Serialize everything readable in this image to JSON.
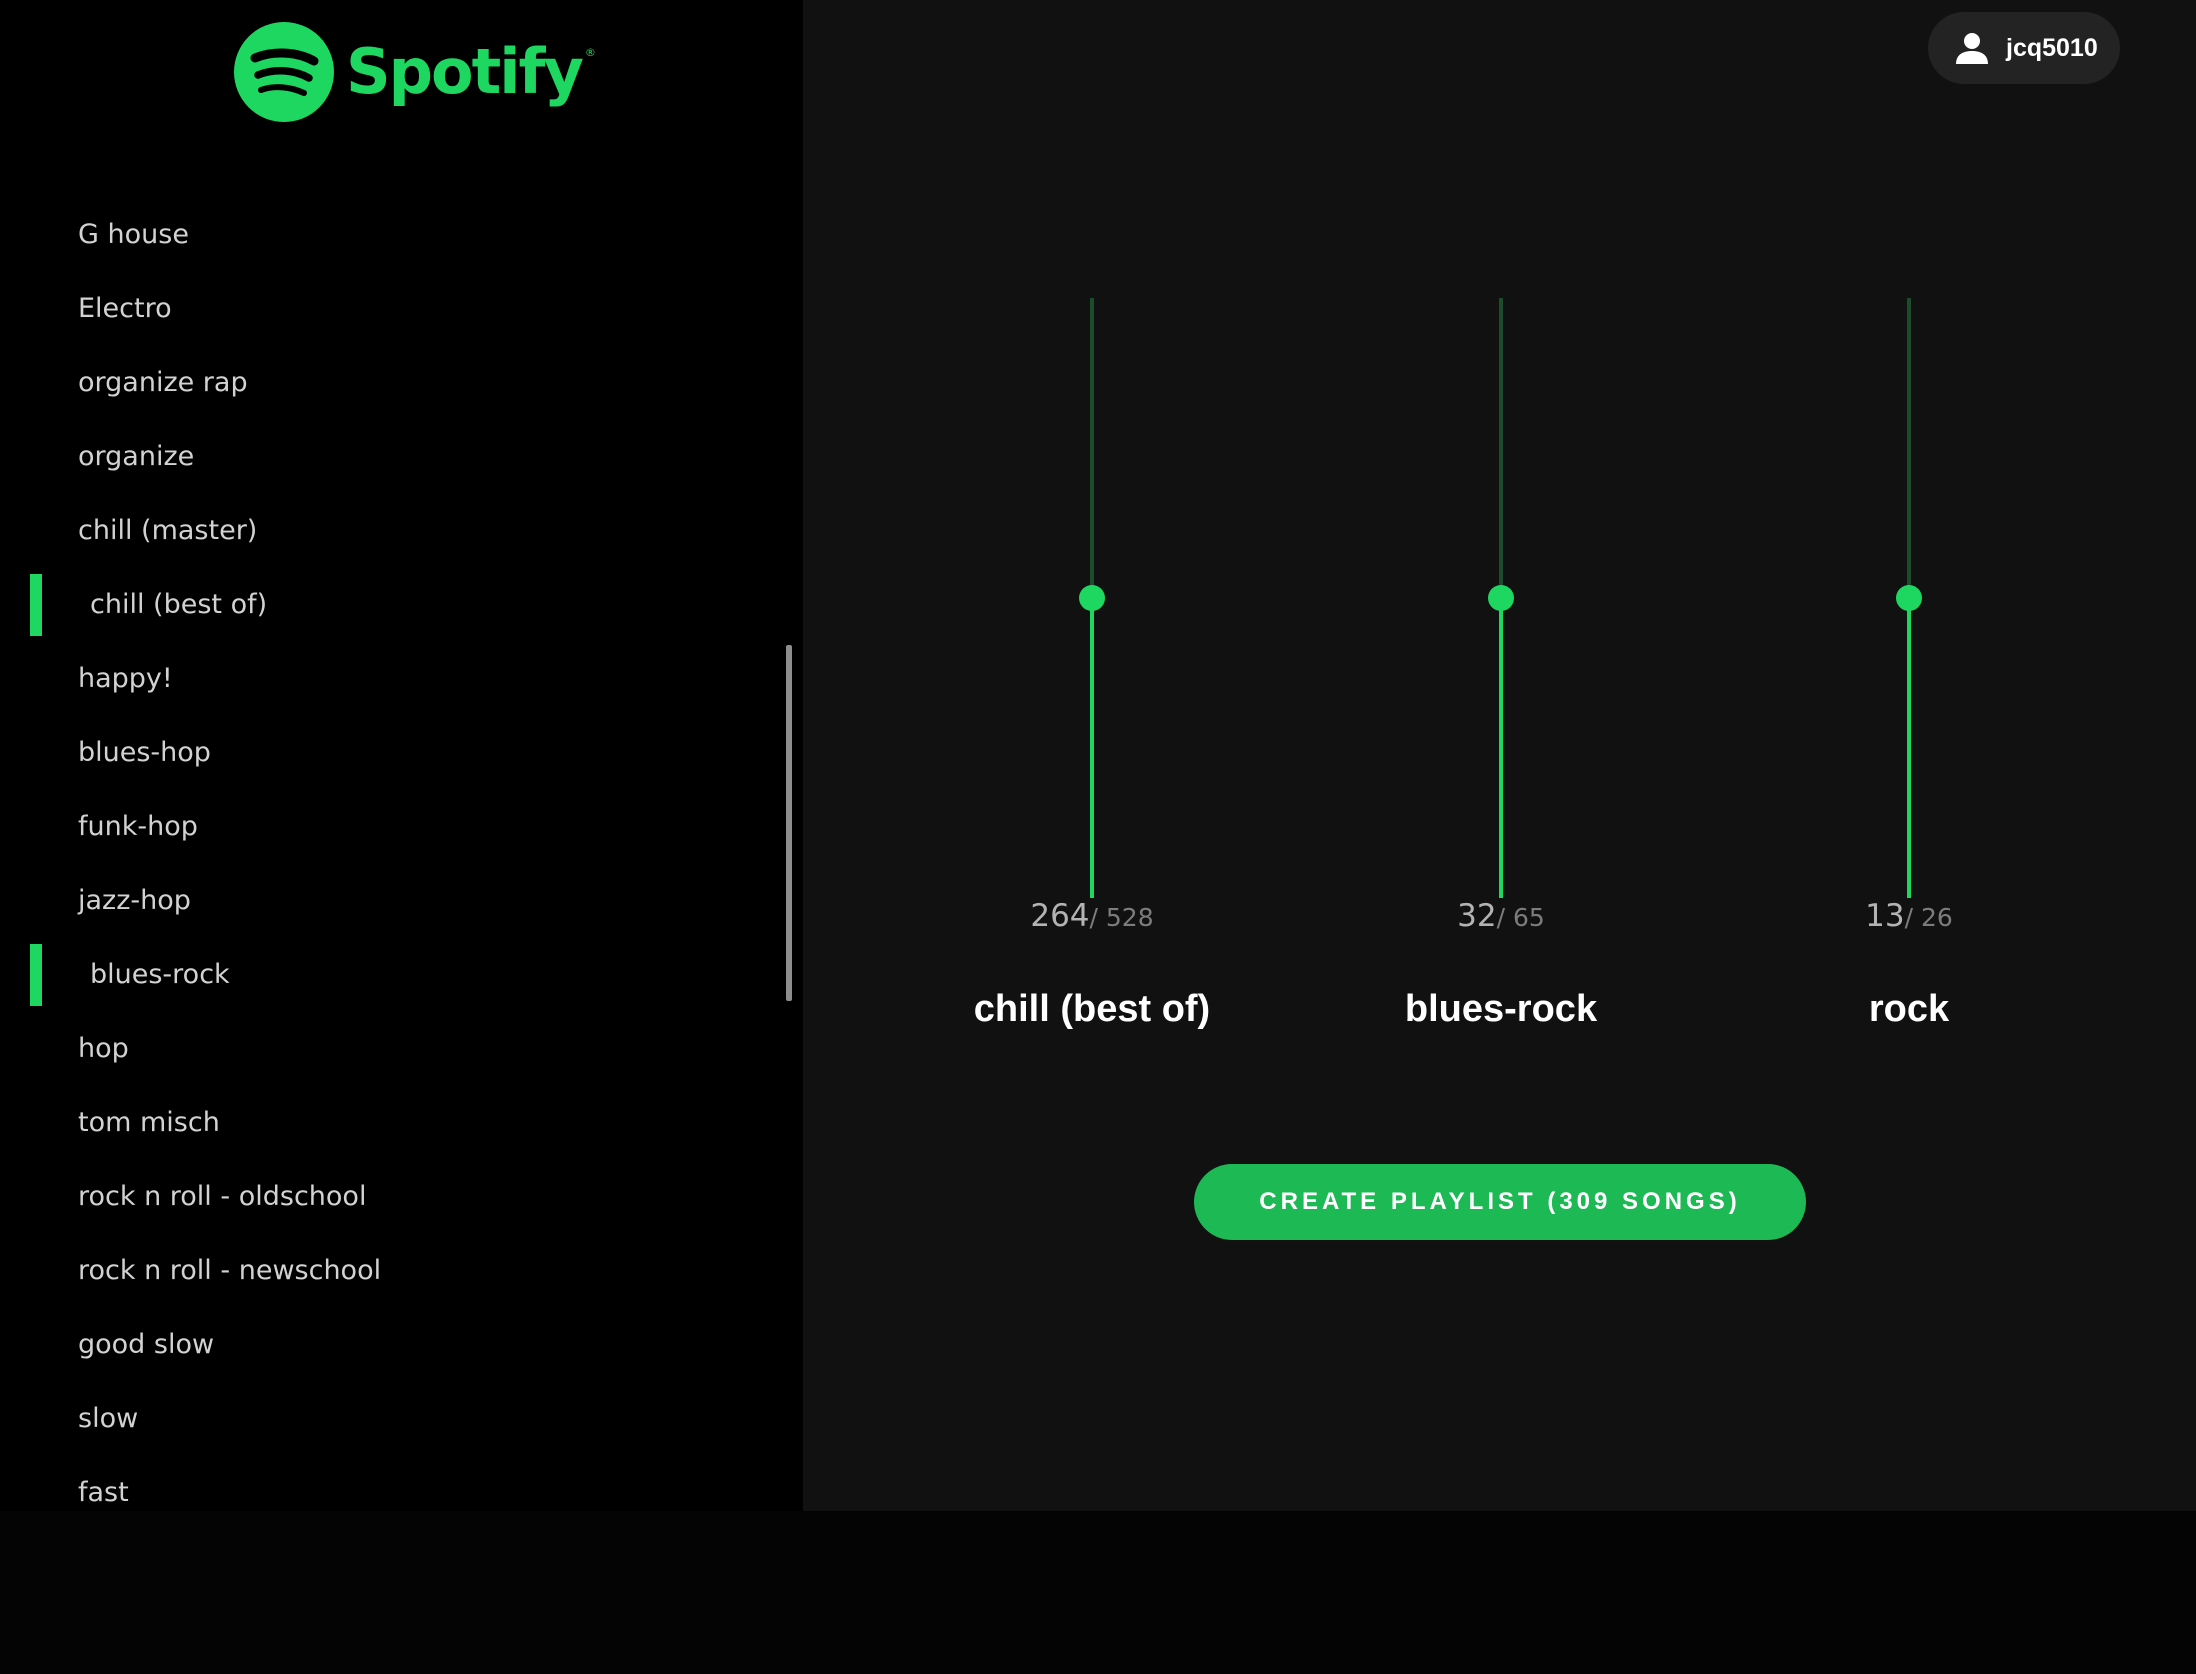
{
  "brand": {
    "name": "Spotify",
    "registered_mark": "®",
    "color": "#1ed760"
  },
  "user": {
    "icon": "user-icon",
    "username": "jcq5010"
  },
  "sidebar": {
    "items": [
      {
        "label": "G house",
        "selected": false
      },
      {
        "label": "Electro",
        "selected": false
      },
      {
        "label": "organize rap",
        "selected": false
      },
      {
        "label": "organize",
        "selected": false
      },
      {
        "label": "chill (master)",
        "selected": false
      },
      {
        "label": "chill (best of)",
        "selected": true
      },
      {
        "label": "happy!",
        "selected": false
      },
      {
        "label": "blues-hop",
        "selected": false
      },
      {
        "label": "funk-hop",
        "selected": false
      },
      {
        "label": "jazz-hop",
        "selected": false
      },
      {
        "label": "blues-rock",
        "selected": true
      },
      {
        "label": "hop",
        "selected": false
      },
      {
        "label": "tom misch",
        "selected": false
      },
      {
        "label": "rock n roll - oldschool",
        "selected": false
      },
      {
        "label": "rock n roll - newschool",
        "selected": false
      },
      {
        "label": "good slow",
        "selected": false
      },
      {
        "label": "slow",
        "selected": false
      },
      {
        "label": "fast",
        "selected": false
      }
    ]
  },
  "mixer": {
    "sliders": [
      {
        "name": "chill (best of)",
        "value": "264",
        "total": "/ 528",
        "level": 0.5
      },
      {
        "name": "blues-rock",
        "value": "32",
        "total": "/ 65",
        "level": 0.5
      },
      {
        "name": "rock",
        "value": "13",
        "total": "/ 26",
        "level": 0.5
      }
    ]
  },
  "actions": {
    "create_label": "CREATE PLAYLIST (309 SONGS)"
  },
  "colors": {
    "accent": "#1ed760",
    "button": "#1db954",
    "track_unfilled": "#1b4d2c",
    "sidebar_bg": "#000000",
    "main_bg": "#111111"
  }
}
